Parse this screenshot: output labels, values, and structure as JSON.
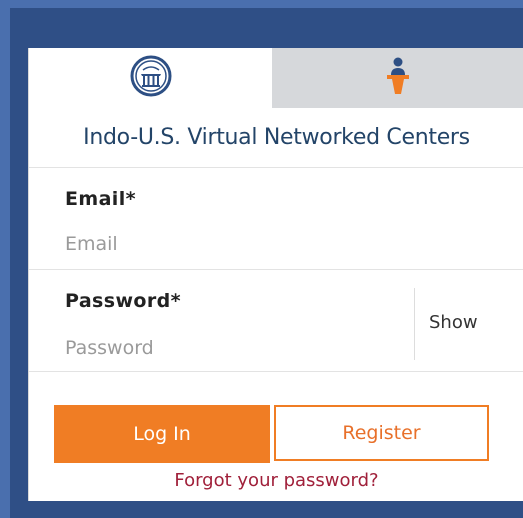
{
  "tabs": {
    "left_icon": "indo-us-seal-logo-icon",
    "right_icon": "presenter-at-podium-icon"
  },
  "title": "Indo-U.S. Virtual Networked Centers",
  "email": {
    "label": "Email*",
    "placeholder": "Email",
    "value": ""
  },
  "password": {
    "label": "Password*",
    "placeholder": "Password",
    "value": "",
    "show_label": "Show"
  },
  "buttons": {
    "login_label": "Log In",
    "register_label": "Register"
  },
  "forgot_label": "Forgot your password?",
  "colors": {
    "accent": "#f07d24",
    "title": "#234468",
    "link": "#a0203a",
    "background": "#4a6fae"
  }
}
